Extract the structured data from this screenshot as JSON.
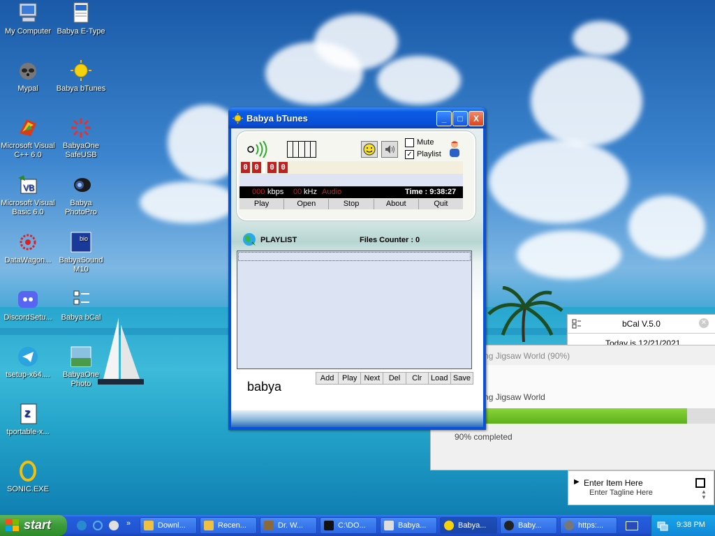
{
  "desktop": {
    "icons": [
      {
        "label": "My Computer"
      },
      {
        "label": "Babya E-Type"
      },
      {
        "label": "Mypal"
      },
      {
        "label": "Babya bTunes"
      },
      {
        "label": "Microsoft Visual C++ 6.0"
      },
      {
        "label": "BabyaOne SafeUSB"
      },
      {
        "label": "Microsoft Visual Basic 6.0"
      },
      {
        "label": "Babya PhotoPro"
      },
      {
        "label": "DataWagon..."
      },
      {
        "label": "BabyaSound M10"
      },
      {
        "label": "DiscordSetu..."
      },
      {
        "label": "Babya bCal"
      },
      {
        "label": "tsetup-x64...."
      },
      {
        "label": "BabyaOne Photo"
      },
      {
        "label": "tportable-x..."
      },
      {
        "label": "SONIC.EXE"
      }
    ]
  },
  "window": {
    "title": "Babya bTunes",
    "minimize": "_",
    "maximize": "□",
    "close": "X"
  },
  "player": {
    "mute_label": "Mute",
    "playlist_label": "Playlist",
    "timer": [
      "0",
      "0",
      "0",
      "0"
    ],
    "kbps_value": "000",
    "kbps_label": "kbps",
    "khz_value": "00",
    "khz_label": "kHz",
    "audio_label": "Audio",
    "time_text": "Time : 9:38:27",
    "buttons": [
      "Play",
      "Open",
      "Stop",
      "About",
      "Quit"
    ],
    "mute_checked": false,
    "playlist_checked": true
  },
  "playlist": {
    "title": "PLAYLIST",
    "counter": "Files Counter : 0",
    "brand": "babya",
    "buttons": [
      "Add",
      "Play",
      "Next",
      "Del",
      "Clr",
      "Load",
      "Save"
    ]
  },
  "bcal": {
    "title": "bCal V.5.0",
    "today": "Today is 12/21/2021"
  },
  "jigsaw": {
    "title": "ading Jigsaw World (90%)",
    "status": "ading Jigsaw World",
    "progress_pct": 90,
    "completed": "90% completed"
  },
  "todo": {
    "item": "Enter Item Here",
    "tagline": "Enter Tagline Here"
  },
  "taskbar": {
    "start": "start",
    "quicklaunch_more": "»",
    "items": [
      "Downl...",
      "Recen...",
      "Dr. W...",
      "C:\\DO...",
      "Babya...",
      "Babya...",
      "Baby...",
      "https:..."
    ],
    "clock": "9:38 PM"
  },
  "colors": {
    "title_blue": "#0a4fd6",
    "lcd_red": "#c02020",
    "start_green": "#3c9a38",
    "progress_green": "#6fc21c"
  }
}
